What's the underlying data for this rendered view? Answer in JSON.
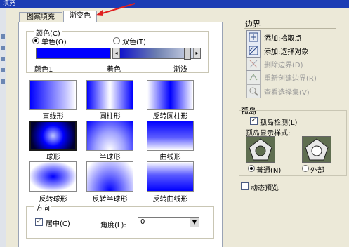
{
  "window": {
    "title": "填充"
  },
  "tabs": [
    {
      "label": "图案填充"
    },
    {
      "label": "渐变色"
    }
  ],
  "color": {
    "group_label": "颜色(C)",
    "single_color_label": "单色(O)",
    "two_color_label": "双色(T)",
    "selected": "单色(O)",
    "color1_label": "颜色1",
    "tint_label": "着色",
    "shade_label": "渐浅",
    "color1_hex": "#0000ff"
  },
  "gradients": [
    {
      "name": "直线形",
      "icon": "linear-gradient-swatch"
    },
    {
      "name": "圆柱形",
      "icon": "cylinder-gradient-swatch"
    },
    {
      "name": "反转圆柱形",
      "icon": "inverted-cylinder-gradient-swatch"
    },
    {
      "name": "球形",
      "icon": "spherical-gradient-swatch"
    },
    {
      "name": "半球形",
      "icon": "hemispherical-gradient-swatch"
    },
    {
      "name": "曲线形",
      "icon": "curved-gradient-swatch"
    },
    {
      "name": "反转球形",
      "icon": "inverted-spherical-gradient-swatch"
    },
    {
      "name": "反转半球形",
      "icon": "inverted-hemispherical-gradient-swatch"
    },
    {
      "name": "反转曲线形",
      "icon": "inverted-curved-gradient-swatch"
    }
  ],
  "orientation": {
    "group_label": "方向",
    "centered_label": "居中(C)",
    "centered_checked": true,
    "angle_label": "角度(L):",
    "angle_value": "0"
  },
  "boundaries": {
    "group_label": "边界",
    "add_pick_points": "添加:拾取点",
    "add_select_objects": "添加:选择对象",
    "remove_boundaries": "删除边界(D)",
    "recreate_boundary": "重新创建边界(R)",
    "view_selections": "查看选择集(V)"
  },
  "islands": {
    "group_label": "孤岛",
    "detection_label": "孤岛检测(L)",
    "detection_checked": true,
    "style_label": "孤岛显示样式:",
    "normal_label": "普通(N)",
    "outer_label": "外部",
    "selected": "普通(N)"
  },
  "preview": {
    "label": "动态预览",
    "checked": false
  },
  "colors": {
    "accent": "#0000ff",
    "titlebar": "#1c3cb4",
    "arrow": "#e02020"
  }
}
